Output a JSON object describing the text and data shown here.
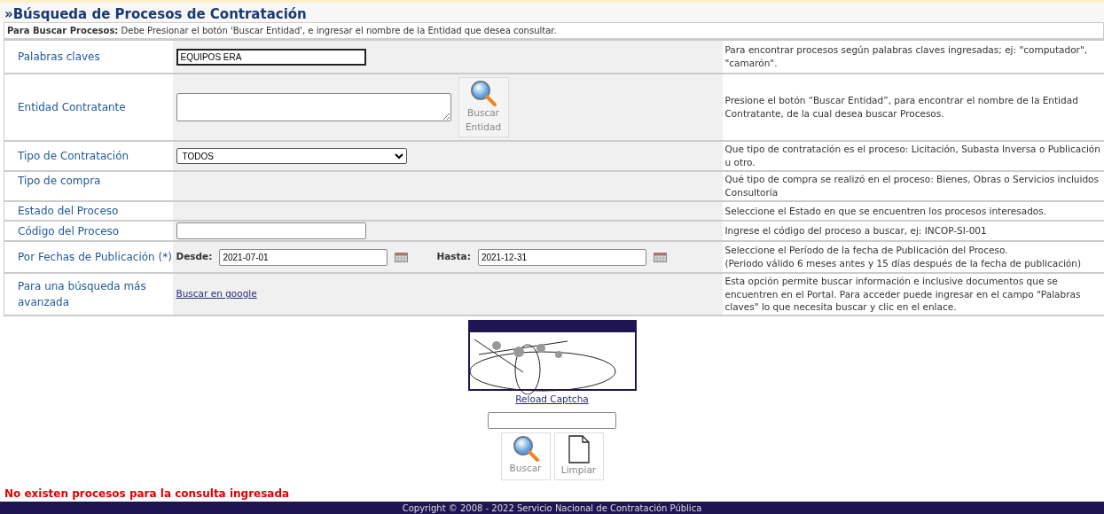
{
  "page_title": "»Búsqueda de Procesos de Contratación",
  "instruction": "**Para Buscar Procesos:** Debe Presionar el botón 'Buscar Entidad', e ingresar el nombre de la Entidad que desea consultar.",
  "rows": [
    {
      "kind": "text_input",
      "label": "Palabras claves",
      "value": "EQUIPOS ERA",
      "description": "Para encontrar procesos según palabras claves ingresadas; ej: \"computador\", \"camarón\"."
    },
    {
      "kind": "textarea",
      "label": "Entidad Contratante",
      "button": "Buscar Entidad",
      "description": "Presione el botón “Buscar Entidad”, para encontrar el nombre de la Entidad Contratante, de la cual desea buscar Procesos."
    },
    {
      "kind": "select",
      "label": "Tipo de Contratación",
      "value": "TODOS",
      "description": "Que tipo de contratación es el proceso: Licitación, Subasta Inversa o Publicación u otro."
    },
    {
      "kind": "empty",
      "label": "Tipo de compra",
      "description": "Qué tipo de compra se realizó en el proceso: Bienes, Obras o Servicios incluidos Consultoría"
    },
    {
      "kind": "empty",
      "label": "Estado del Proceso",
      "description": "Seleccione el Estado en que se encuentren los procesos interesados."
    },
    {
      "kind": "text_input",
      "label": "Código del Proceso",
      "description": "Ingrese el código del proceso a buscar, ej: INCOP-SI-001"
    },
    {
      "kind": "date_range",
      "label": "Por Fechas de Publicación (*)",
      "dates": [
        {
          "label": "Desde:",
          "value": "2021-07-01"
        },
        {
          "label": "Hasta:",
          "value": "2021-12-31"
        }
      ],
      "description": "Seleccione el Período de la fecha de Publicación del Proceso.\n(Periodo válido 6 meses antes y 15 días después de la fecha de publicación)"
    },
    {
      "kind": "link",
      "label": "Para una búsqueda más avanzada",
      "link": "Buscar en google",
      "description": "Esta opción permite buscar información e inclusive documentos que se encuentren en el Portal. Para acceder puede ingresar en el campo \"Palabras claves\" lo que necesita buscar y clic en el enlace."
    }
  ],
  "captcha": {
    "reload_link": "Reload Captcha"
  },
  "buttons": [
    {
      "kind": "search",
      "label": "Buscar"
    },
    {
      "kind": "clear",
      "label": "Limpiar"
    }
  ],
  "message": "No existen procesos para la consulta ingresada",
  "footer": "Copyright © 2008 - 2022 Servicio Nacional de Contratación Pública"
}
